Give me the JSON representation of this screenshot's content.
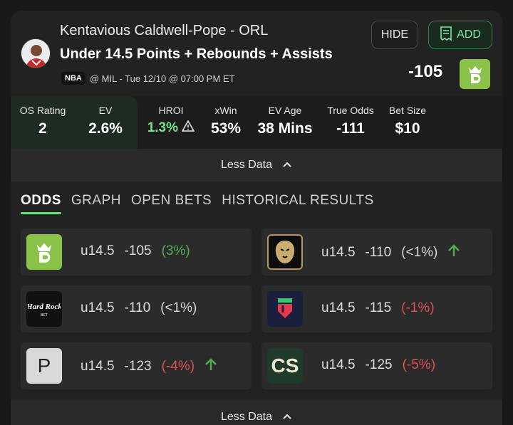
{
  "header": {
    "player_name": "Kentavious Caldwell-Pope - ORL",
    "prop": "Under 14.5 Points + Rebounds + Assists",
    "league": "NBA",
    "game": "@ MIL - Tue 12/10 @ 07:00 PM ET",
    "hide_label": "HIDE",
    "add_label": "ADD",
    "odds": "-105"
  },
  "stats": {
    "os_rating_label": "OS Rating",
    "os_rating": "2",
    "ev_label": "EV",
    "ev": "2.6%",
    "hroi_label": "HROI",
    "hroi": "1.3%",
    "xwin_label": "xWin",
    "xwin": "53%",
    "ev_age_label": "EV Age",
    "ev_age": "38 Mins",
    "true_odds_label": "True Odds",
    "true_odds": "-111",
    "bet_size_label": "Bet Size",
    "bet_size": "$10"
  },
  "less_data_label": "Less Data",
  "tabs": [
    "ODDS",
    "GRAPH",
    "OPEN BETS",
    "HISTORICAL RESULTS"
  ],
  "odds_rows": [
    {
      "book": "DraftKings",
      "line": "u14.5",
      "price": "-105",
      "ev": "(3%)"
    },
    {
      "book": "BetMGM",
      "line": "u14.5",
      "price": "-110",
      "ev": "(<1%)"
    },
    {
      "book": "Hard Rock Bet",
      "line": "u14.5",
      "price": "-110",
      "ev": "(<1%)"
    },
    {
      "book": "Fliff",
      "line": "u14.5",
      "price": "-115",
      "ev": "(-1%)"
    },
    {
      "book": "P",
      "line": "u14.5",
      "price": "-123",
      "ev": "(-4%)"
    },
    {
      "book": "CS",
      "line": "u14.5",
      "price": "-125",
      "ev": "(-5%)"
    }
  ],
  "colors": {
    "accent": "#6fdc86",
    "negative": "#d9534f",
    "draftkings": "#8bc34a"
  }
}
